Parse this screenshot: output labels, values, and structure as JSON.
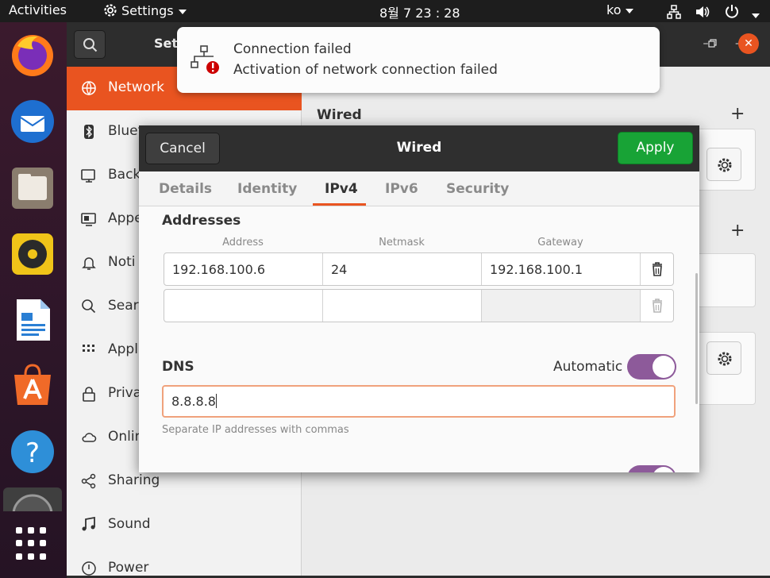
{
  "topbar": {
    "activities": "Activities",
    "app_menu": "Settings",
    "clock": "8월 7  23 : 28",
    "input_method": "ko",
    "icons": [
      "network-icon",
      "volume-icon",
      "power-icon"
    ]
  },
  "dock": {
    "apps": [
      "firefox-icon",
      "thunderbird-icon",
      "files-icon",
      "rhythmbox-icon",
      "writer-icon",
      "software-icon",
      "help-icon",
      "disc-icon"
    ],
    "show_apps": "apps-grid-icon"
  },
  "settings": {
    "header_title": "Set",
    "sidebar": [
      {
        "label": "Network",
        "icon": "network-icon"
      },
      {
        "label": "Bluet",
        "icon": "bluetooth-icon"
      },
      {
        "label": "Back",
        "icon": "background-icon"
      },
      {
        "label": "Appe",
        "icon": "appearance-icon"
      },
      {
        "label": "Noti",
        "icon": "bell-icon"
      },
      {
        "label": "Sear",
        "icon": "search-icon"
      },
      {
        "label": "Appl",
        "icon": "apps-icon"
      },
      {
        "label": "Priva",
        "icon": "lock-icon"
      },
      {
        "label": "Onlin",
        "icon": "cloud-icon"
      },
      {
        "label": "Sharing",
        "icon": "share-icon"
      },
      {
        "label": "Sound",
        "icon": "music-icon"
      },
      {
        "label": "Power",
        "icon": "power-icon"
      }
    ],
    "wired_section": "Wired"
  },
  "notification": {
    "title": "Connection failed",
    "body": "Activation of network connection failed"
  },
  "dialog": {
    "title": "Wired",
    "cancel_label": "Cancel",
    "apply_label": "Apply",
    "tabs": [
      "Details",
      "Identity",
      "IPv4",
      "IPv6",
      "Security"
    ],
    "active_tab": "IPv4",
    "addresses_title": "Addresses",
    "columns": [
      "Address",
      "Netmask",
      "Gateway"
    ],
    "rows": [
      {
        "address": "192.168.100.6",
        "netmask": "24",
        "gateway": "192.168.100.1"
      },
      {
        "address": "",
        "netmask": "",
        "gateway": ""
      }
    ],
    "dns_title": "DNS",
    "dns_automatic_label": "Automatic",
    "dns_automatic": true,
    "dns_value": "8.8.8.8",
    "dns_hint": "Separate IP addresses with commas"
  },
  "colors": {
    "accent": "#e95420",
    "apply_green": "#18a336",
    "toggle_on": "#8d5a9a"
  }
}
